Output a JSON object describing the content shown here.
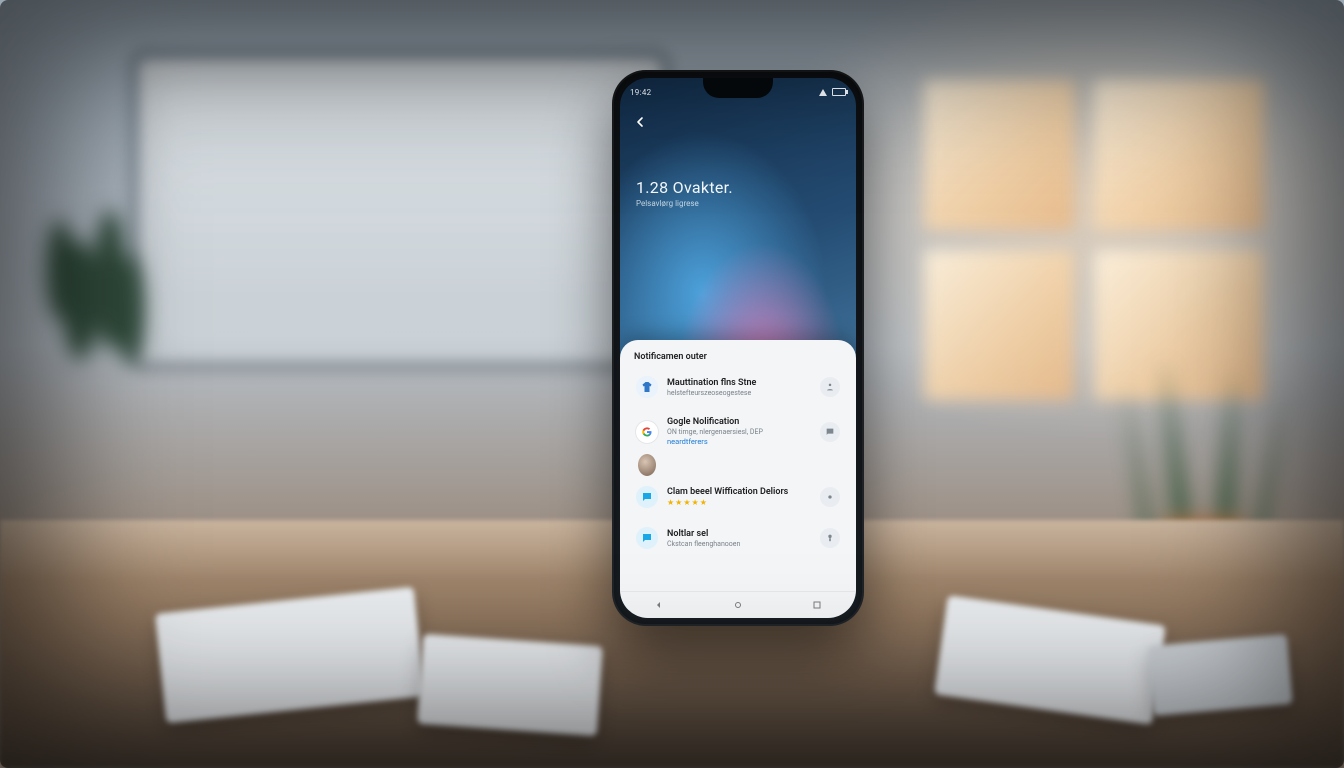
{
  "statusbar": {
    "time": "19:42"
  },
  "header": {
    "title": "1.28 Ovakter.",
    "subtitle": "Pelsavlørg ligrese"
  },
  "panel": {
    "header": "Notificamen outer",
    "items": [
      {
        "icon": "shirt-icon",
        "icon_bg": "#eaf2fb",
        "icon_fg": "#2f77c9",
        "title": "Mauttination flns Stne",
        "subtitle": "helstefteurszeoseogestese"
      },
      {
        "icon": "google-icon",
        "icon_bg": "#ffffff",
        "icon_fg": "#4285f4",
        "title": "Gogle Nolification",
        "subtitle": "ON timge, nlergenaersiesl, DEP",
        "link": "neardtferers"
      },
      {
        "icon": "message-icon",
        "icon_bg": "#dff1fb",
        "icon_fg": "#1aa7e6",
        "title": "Clam beeel Wiffication Deliors",
        "stars": "★★★★★"
      },
      {
        "icon": "message-icon",
        "icon_bg": "#dff1fb",
        "icon_fg": "#1aa7e6",
        "title": "Noltlar sel",
        "subtitle": "Ckstcan fleenghanooen"
      }
    ]
  }
}
